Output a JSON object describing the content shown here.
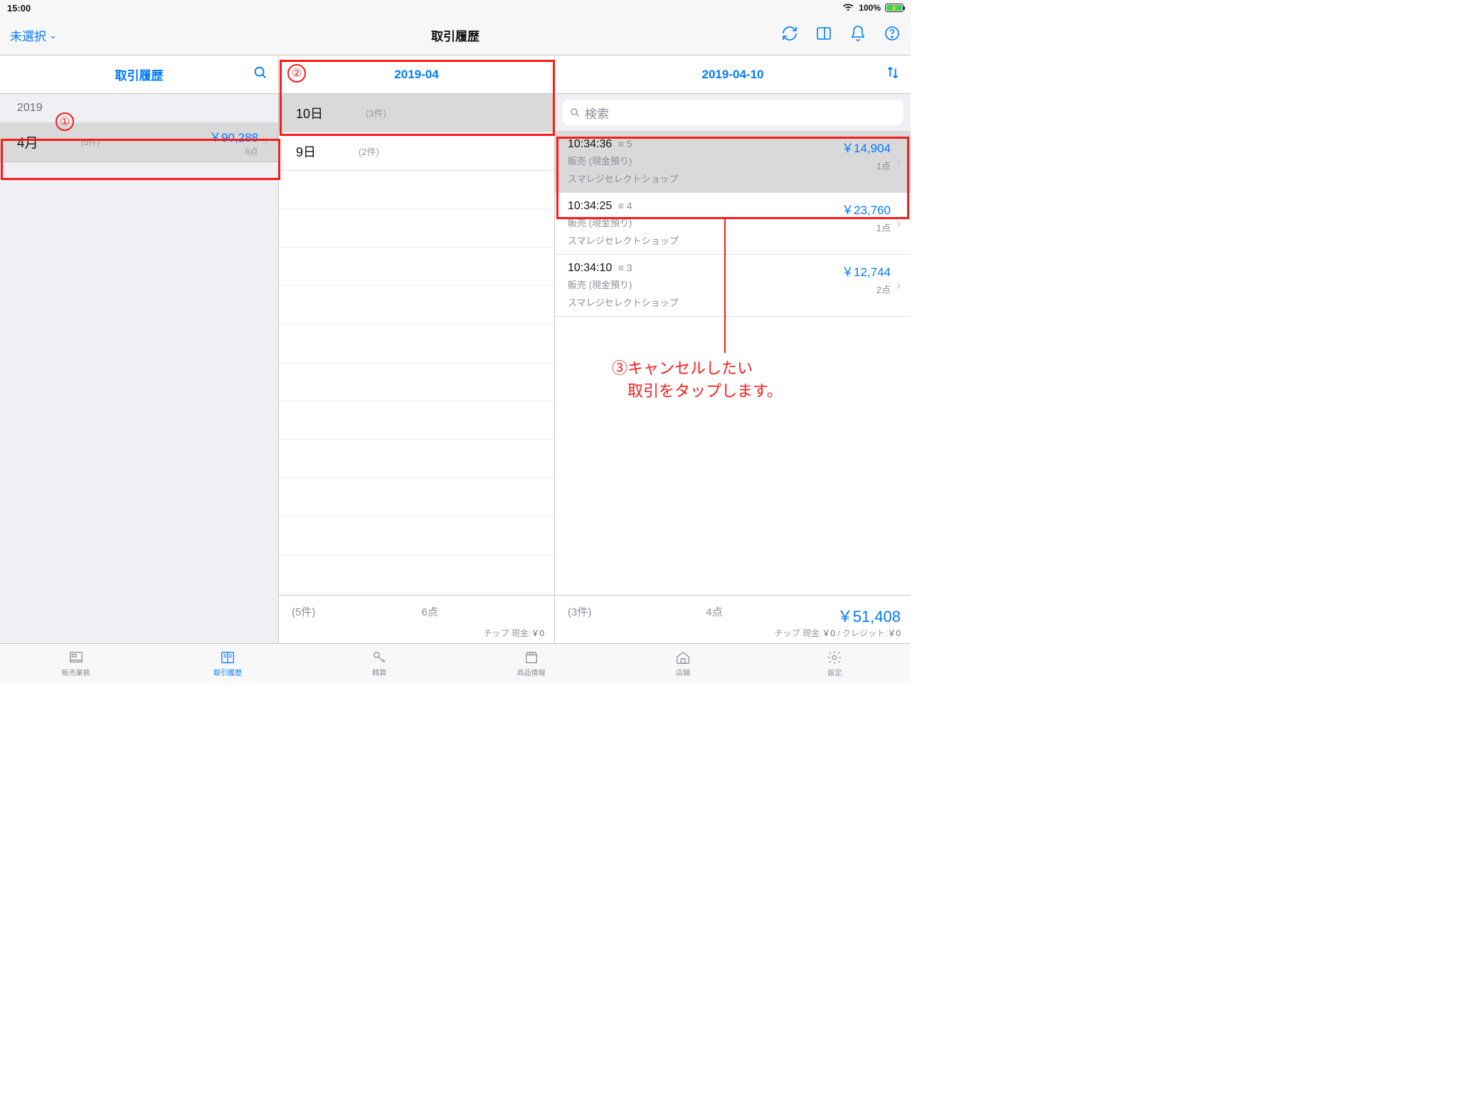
{
  "status": {
    "time": "15:00",
    "batteryPct": "100%"
  },
  "nav": {
    "leftLabel": "未選択",
    "title": "取引履歴"
  },
  "columns": {
    "c1": "取引履歴",
    "c2": "2019-04",
    "c3": "2019-04-10"
  },
  "pane1": {
    "year": "2019",
    "month": {
      "name": "4月",
      "count": "(5件)",
      "amount": "￥90,288",
      "points": "6点"
    }
  },
  "pane2": {
    "days": [
      {
        "name": "10日",
        "count": "(3件)",
        "sel": true
      },
      {
        "name": "9日",
        "count": "(2件)",
        "sel": false
      }
    ],
    "summary": {
      "count": "(5件)",
      "points": "6点",
      "tipLabel": "チップ 現金:",
      "tipAmt": "￥0"
    }
  },
  "pane3": {
    "searchPlaceholder": "検索",
    "tx": [
      {
        "time": "10:34:36",
        "sid": "≡ 5",
        "type": "販売 (現金預り)",
        "store": "スマレジセレクトショップ",
        "amount": "￥14,904",
        "points": "1点",
        "sel": true
      },
      {
        "time": "10:34:25",
        "sid": "≡ 4",
        "type": "販売 (現金預り)",
        "store": "スマレジセレクトショップ",
        "amount": "￥23,760",
        "points": "1点",
        "sel": false
      },
      {
        "time": "10:34:10",
        "sid": "≡ 3",
        "type": "販売 (現金預り)",
        "store": "スマレジセレクトショップ",
        "amount": "￥12,744",
        "points": "2点",
        "sel": false
      }
    ],
    "summary": {
      "count": "(3件)",
      "points": "4点",
      "total": "￥51,408",
      "tipLabel": "チップ 現金:",
      "tipAmt": "￥0",
      "creditLabel": " / クレジット:",
      "creditAmt": "￥0"
    }
  },
  "tabs": [
    {
      "label": "販売業務"
    },
    {
      "label": "取引履歴"
    },
    {
      "label": "精算"
    },
    {
      "label": "商品情報"
    },
    {
      "label": "店舗"
    },
    {
      "label": "設定"
    }
  ],
  "annotations": {
    "c1": "①",
    "c2": "②",
    "c3": "③",
    "text": "③キャンセルしたい\n　取引をタップします。"
  }
}
